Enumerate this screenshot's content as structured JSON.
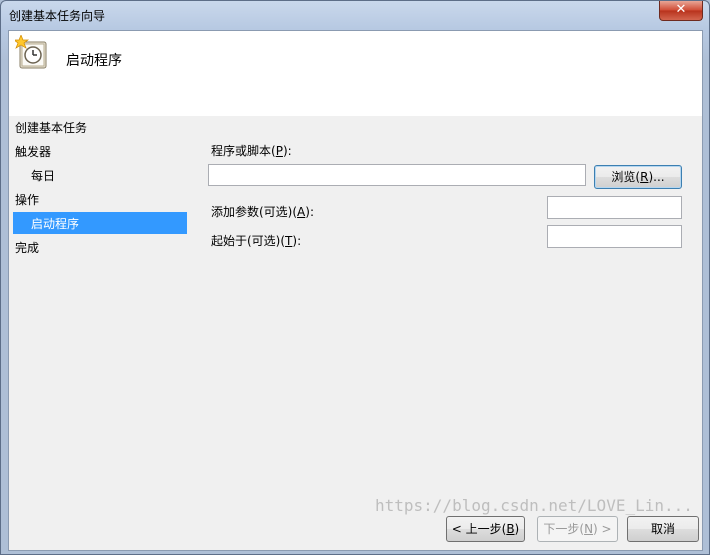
{
  "window": {
    "title": "创建基本任务向导",
    "close_glyph": "✕"
  },
  "header": {
    "title": "启动程序",
    "icon": "task-clock-icon"
  },
  "steps": {
    "heading": "创建基本任务",
    "items": [
      {
        "label": "触发器"
      },
      {
        "label": "每日"
      },
      {
        "label": "操作"
      },
      {
        "label": "启动程序",
        "selected": true
      },
      {
        "label": "完成"
      }
    ]
  },
  "form": {
    "program_label_pre": "程序或脚本(",
    "program_label_key": "P",
    "program_label_post": "):",
    "program_value": "",
    "browse_pre": "浏览(",
    "browse_key": "R",
    "browse_post": ")...",
    "args_label_pre": "添加参数(可选)(",
    "args_label_key": "A",
    "args_label_post": "):",
    "args_value": "",
    "start_label_pre": "起始于(可选)(",
    "start_label_key": "T",
    "start_label_post": "):",
    "start_value": ""
  },
  "footer": {
    "back_pre": "< 上一步(",
    "back_key": "B",
    "back_post": ")",
    "next_pre": "下一步(",
    "next_key": "N",
    "next_post": ") >",
    "cancel_label": "取消"
  },
  "watermark": "https://blog.csdn.net/LOVE_Lin..."
}
